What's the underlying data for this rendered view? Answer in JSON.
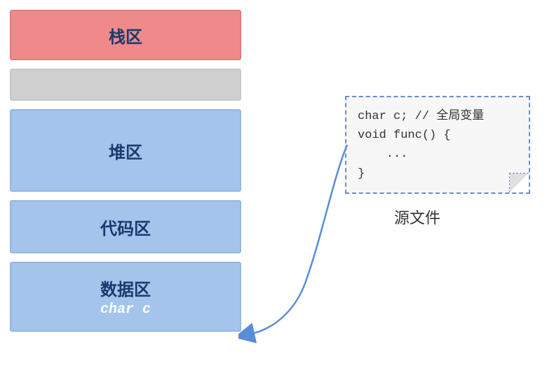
{
  "memory": {
    "stack_label": "栈区",
    "heap_label": "堆区",
    "code_label": "代码区",
    "data_label": "数据区",
    "data_var": "char c"
  },
  "source": {
    "line1": "char c; // 全局变量",
    "line2": "",
    "line3": "void func() {",
    "line4": "    ...",
    "line5": "}",
    "caption": "源文件"
  },
  "colors": {
    "stack": "#f08a8a",
    "gray": "#d0d0d0",
    "blue": "#a5c4ec",
    "text": "#1a3a6e",
    "arrow": "#5a8dd8"
  }
}
